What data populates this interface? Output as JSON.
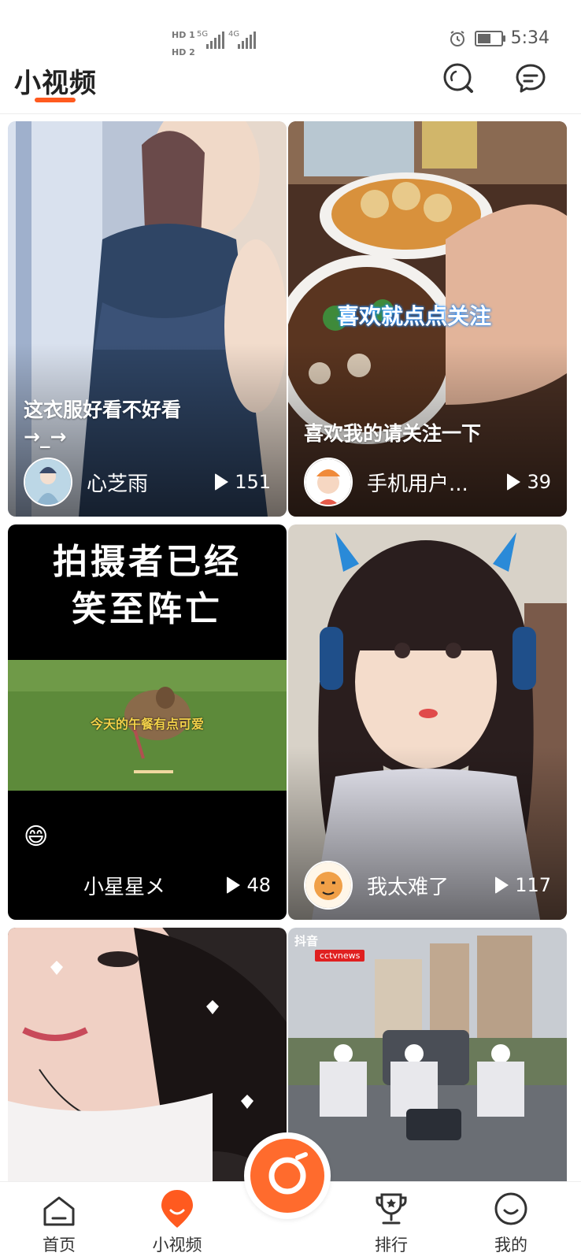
{
  "status_bar": {
    "hd1": "HD 1",
    "hd2": "HD 2",
    "net1": "5G",
    "net2": "4G",
    "time": "5:34",
    "icons": [
      "alarm-icon",
      "battery-icon"
    ]
  },
  "header": {
    "title": "小视频",
    "accent_color": "#ff5a1f",
    "icons": [
      "search-icon",
      "message-icon"
    ]
  },
  "feed": {
    "cards": [
      {
        "caption": "这衣服好看不好看\n→_→",
        "author": "心芝雨",
        "plays": "151",
        "overlay_text": ""
      },
      {
        "caption": "喜欢我的请关注一下",
        "author": "手机用户...",
        "plays": "39",
        "overlay_text": "喜欢就点点关注"
      },
      {
        "caption": "😄",
        "author": "小星星メ",
        "plays": "48",
        "overlay_text": "拍摄者已经\n笑至阵亡",
        "subtitle": "今天的午餐有点可爱"
      },
      {
        "caption": "",
        "author": "我太难了",
        "plays": "117",
        "overlay_text": ""
      },
      {
        "caption": "",
        "author": "",
        "plays": "",
        "overlay_text": ""
      },
      {
        "caption": "",
        "author": "",
        "plays": "",
        "overlay_text": "",
        "watermark": "抖音",
        "badge": "cctvnews"
      }
    ]
  },
  "bottom_nav": {
    "items": [
      {
        "label": "首页",
        "icon": "home-icon"
      },
      {
        "label": "小视频",
        "icon": "location-pin-icon"
      },
      {
        "label": "",
        "icon": "camera-capture-icon"
      },
      {
        "label": "排行",
        "icon": "trophy-icon"
      },
      {
        "label": "我的",
        "icon": "profile-icon"
      }
    ],
    "active_color": "#ff5a1f"
  }
}
